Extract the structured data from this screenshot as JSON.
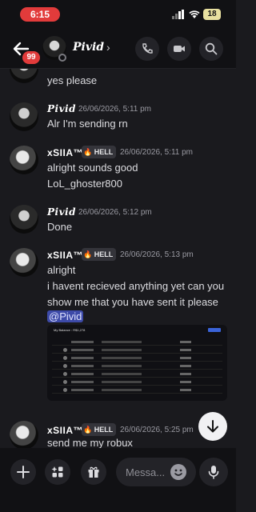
{
  "status": {
    "time": "6:15",
    "battery": "18"
  },
  "header": {
    "unread_count": "99",
    "channel_name": "Pivid",
    "chevron": "›"
  },
  "messages": [
    {
      "text": "yes please"
    },
    {
      "author": "Pivid",
      "timestamp": "26/06/2026, 5:11 pm",
      "text": "Alr I'm sending rn"
    },
    {
      "author": "xSIIA™",
      "tag": "HELL",
      "timestamp": "26/06/2026, 5:11 pm",
      "lines": [
        "alright sounds good",
        "LoL_ghoster800"
      ]
    },
    {
      "author": "Pivid",
      "timestamp": "26/06/2026, 5:12 pm",
      "text": "Done"
    },
    {
      "author": "xSIIA™",
      "tag": "HELL",
      "timestamp": "26/06/2026, 5:13 pm",
      "line1": "alright",
      "line2": "i havent recieved anything yet can you show me that you have sent it please",
      "mention": "@Pivid"
    },
    {
      "author": "xSIIA™",
      "tag": "HELL",
      "timestamp": "26/06/2026, 5:25 pm",
      "text": "send me  my robux"
    }
  ],
  "attachment": {
    "title": "My Balance : R$1,278"
  },
  "composer": {
    "placeholder": "Messa..."
  },
  "colors": {
    "accent": "#e23b3b",
    "mention_bg": "#3d4aa8",
    "background": "#1a1a1e"
  }
}
